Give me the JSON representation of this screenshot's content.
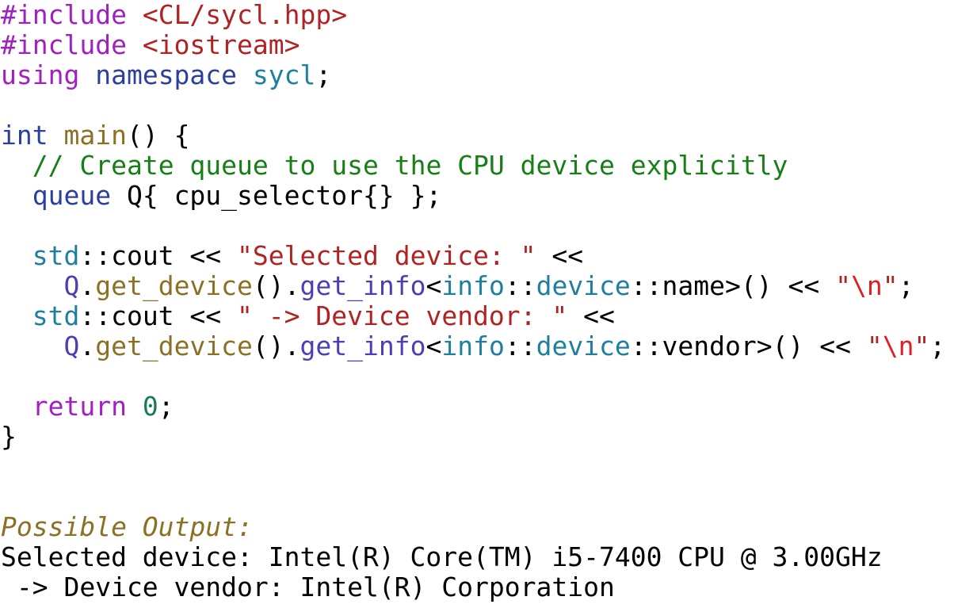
{
  "document": {
    "kind": "code-listing",
    "language": "C++ / SYCL",
    "background_color": "#ffffff",
    "font_size_px": 33,
    "line_height_px": 38,
    "palette": {
      "plain": "#000000",
      "preprocessor": "#a020c0",
      "header_string": "#b22222",
      "keyword": "#a020c0",
      "type": "#2b3f9e",
      "namespace": "#2b3f9e",
      "class_name": "#1f7f9e",
      "function": "#8a7124",
      "method": "#4b3fb5",
      "variable": "#4b3fb5",
      "string": "#b22222",
      "escape": "#e02020",
      "comment": "#168016",
      "number": "#177d55",
      "output_label": "#8a7124",
      "output_text": "#000000"
    }
  },
  "lines": [
    {
      "index": 0,
      "text": "#include <CL/sycl.hpp>",
      "tokens": [
        {
          "t": "#include",
          "c": "tok-preproc"
        },
        {
          "t": " ",
          "c": "tok-plain"
        },
        {
          "t": "<CL/sycl.hpp>",
          "c": "tok-header"
        }
      ]
    },
    {
      "index": 1,
      "text": "#include <iostream>",
      "tokens": [
        {
          "t": "#include",
          "c": "tok-preproc"
        },
        {
          "t": " ",
          "c": "tok-plain"
        },
        {
          "t": "<iostream>",
          "c": "tok-header"
        }
      ]
    },
    {
      "index": 2,
      "text": "using namespace sycl;",
      "tokens": [
        {
          "t": "using",
          "c": "tok-keyword"
        },
        {
          "t": " ",
          "c": "tok-plain"
        },
        {
          "t": "namespace",
          "c": "tok-ns"
        },
        {
          "t": " ",
          "c": "tok-plain"
        },
        {
          "t": "sycl",
          "c": "tok-class"
        },
        {
          "t": ";",
          "c": "tok-plain"
        }
      ]
    },
    {
      "index": 3,
      "text": "",
      "tokens": []
    },
    {
      "index": 4,
      "text": "int main() {",
      "tokens": [
        {
          "t": "int",
          "c": "tok-type"
        },
        {
          "t": " ",
          "c": "tok-plain"
        },
        {
          "t": "main",
          "c": "tok-func"
        },
        {
          "t": "() {",
          "c": "tok-plain"
        }
      ]
    },
    {
      "index": 5,
      "text": "  // Create queue to use the CPU device explicitly",
      "tokens": [
        {
          "t": "  ",
          "c": "tok-plain"
        },
        {
          "t": "// Create queue to use the CPU device explicitly",
          "c": "tok-comment"
        }
      ]
    },
    {
      "index": 6,
      "text": "  queue Q{ cpu_selector{} };",
      "tokens": [
        {
          "t": "  ",
          "c": "tok-plain"
        },
        {
          "t": "queue",
          "c": "tok-type"
        },
        {
          "t": " Q{ cpu_selector{} };",
          "c": "tok-plain"
        }
      ]
    },
    {
      "index": 7,
      "text": "",
      "tokens": []
    },
    {
      "index": 8,
      "text": "  std::cout << \"Selected device: \" <<",
      "tokens": [
        {
          "t": "  ",
          "c": "tok-plain"
        },
        {
          "t": "std",
          "c": "tok-class"
        },
        {
          "t": "::cout << ",
          "c": "tok-plain"
        },
        {
          "t": "\"Selected device: \"",
          "c": "tok-string"
        },
        {
          "t": " <<",
          "c": "tok-plain"
        }
      ]
    },
    {
      "index": 9,
      "text": "    Q.get_device().get_info<info::device::name>() << \"\\n\";",
      "tokens": [
        {
          "t": "    ",
          "c": "tok-plain"
        },
        {
          "t": "Q",
          "c": "tok-var"
        },
        {
          "t": ".",
          "c": "tok-plain"
        },
        {
          "t": "get_device",
          "c": "tok-func"
        },
        {
          "t": "().",
          "c": "tok-plain"
        },
        {
          "t": "get_info",
          "c": "tok-method"
        },
        {
          "t": "<",
          "c": "tok-plain"
        },
        {
          "t": "info",
          "c": "tok-class"
        },
        {
          "t": "::",
          "c": "tok-plain"
        },
        {
          "t": "device",
          "c": "tok-class"
        },
        {
          "t": "::name>() << ",
          "c": "tok-plain"
        },
        {
          "t": "\"",
          "c": "tok-string"
        },
        {
          "t": "\\n",
          "c": "tok-escape"
        },
        {
          "t": "\"",
          "c": "tok-string"
        },
        {
          "t": ";",
          "c": "tok-plain"
        }
      ]
    },
    {
      "index": 10,
      "text": "  std::cout << \" -> Device vendor: \" <<",
      "tokens": [
        {
          "t": "  ",
          "c": "tok-plain"
        },
        {
          "t": "std",
          "c": "tok-class"
        },
        {
          "t": "::cout << ",
          "c": "tok-plain"
        },
        {
          "t": "\" -> Device vendor: \"",
          "c": "tok-string"
        },
        {
          "t": " <<",
          "c": "tok-plain"
        }
      ]
    },
    {
      "index": 11,
      "text": "    Q.get_device().get_info<info::device::vendor>() << \"\\n\";",
      "tokens": [
        {
          "t": "    ",
          "c": "tok-plain"
        },
        {
          "t": "Q",
          "c": "tok-var"
        },
        {
          "t": ".",
          "c": "tok-plain"
        },
        {
          "t": "get_device",
          "c": "tok-func"
        },
        {
          "t": "().",
          "c": "tok-plain"
        },
        {
          "t": "get_info",
          "c": "tok-method"
        },
        {
          "t": "<",
          "c": "tok-plain"
        },
        {
          "t": "info",
          "c": "tok-class"
        },
        {
          "t": "::",
          "c": "tok-plain"
        },
        {
          "t": "device",
          "c": "tok-class"
        },
        {
          "t": "::vendor>() << ",
          "c": "tok-plain"
        },
        {
          "t": "\"",
          "c": "tok-string"
        },
        {
          "t": "\\n",
          "c": "tok-escape"
        },
        {
          "t": "\"",
          "c": "tok-string"
        },
        {
          "t": ";",
          "c": "tok-plain"
        }
      ]
    },
    {
      "index": 12,
      "text": "",
      "tokens": []
    },
    {
      "index": 13,
      "text": "  return 0;",
      "tokens": [
        {
          "t": "  ",
          "c": "tok-plain"
        },
        {
          "t": "return",
          "c": "tok-keyword"
        },
        {
          "t": " ",
          "c": "tok-plain"
        },
        {
          "t": "0",
          "c": "tok-number"
        },
        {
          "t": ";",
          "c": "tok-plain"
        }
      ]
    },
    {
      "index": 14,
      "text": "}",
      "tokens": [
        {
          "t": "}",
          "c": "tok-plain"
        }
      ]
    },
    {
      "index": 15,
      "text": "",
      "tokens": []
    },
    {
      "index": 16,
      "text": "",
      "tokens": []
    },
    {
      "index": 17,
      "text": "Possible Output:",
      "tokens": [
        {
          "t": "Possible Output:",
          "c": "tok-output-label"
        }
      ]
    },
    {
      "index": 18,
      "text": "Selected device: Intel(R) Core(TM) i5-7400 CPU @ 3.00GHz",
      "tokens": [
        {
          "t": "Selected device: Intel(R) Core(TM) i5-7400 CPU @ 3.00GHz",
          "c": "tok-output"
        }
      ]
    },
    {
      "index": 19,
      "text": " -> Device vendor: Intel(R) Corporation",
      "tokens": [
        {
          "t": " -> Device vendor: Intel(R) Corporation",
          "c": "tok-output"
        }
      ]
    }
  ],
  "program": {
    "includes": [
      "<CL/sycl.hpp>",
      "<iostream>"
    ],
    "using_namespace": "sycl",
    "entry_point": "main",
    "comment": "// Create queue to use the CPU device explicitly",
    "queue_declaration": "queue Q{ cpu_selector{} };",
    "return_value": "0"
  },
  "output": {
    "label": "Possible Output:",
    "lines": [
      "Selected device: Intel(R) Core(TM) i5-7400 CPU @ 3.00GHz",
      " -> Device vendor: Intel(R) Corporation"
    ],
    "device_name": "Intel(R) Core(TM) i5-7400 CPU @ 3.00GHz",
    "device_vendor": "Intel(R) Corporation"
  }
}
